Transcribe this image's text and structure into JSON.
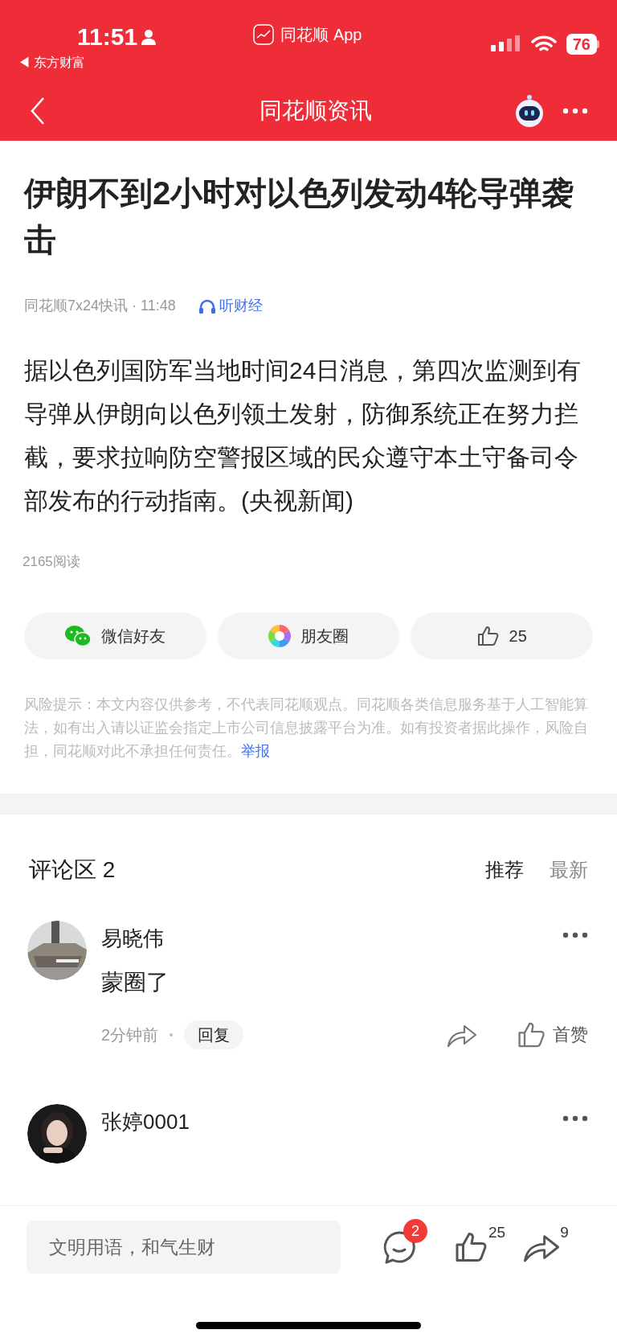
{
  "status_bar": {
    "time": "11:51",
    "app_title": "同花顺 App",
    "back_app": "◀ 东方财富",
    "battery": "76"
  },
  "nav": {
    "title": "同花顺资讯"
  },
  "article": {
    "title": "伊朗不到2小时对以色列发动4轮导弹袭击",
    "source": "同花顺7x24快讯 · 11:48",
    "listen": "听财经",
    "body": "据以色列国防军当地时间24日消息，第四次监测到有导弹从伊朗向以色列领土发射，防御系统正在努力拦截，要求拉响防空警报区域的民众遵守本土守备司令部发布的行动指南。(央视新闻)",
    "reads": "2165阅读"
  },
  "share_buttons": [
    {
      "kind": "wechat",
      "label": "微信好友"
    },
    {
      "kind": "moments",
      "label": "朋友圈"
    },
    {
      "kind": "like",
      "label": "25"
    }
  ],
  "disclaimer": {
    "text": "风险提示：本文内容仅供参考，不代表同花顺观点。同花顺各类信息服务基于人工智能算法，如有出入请以证监会指定上市公司信息披露平台为准。如有投资者据此操作，风险自担，同花顺对此不承担任何责任。",
    "link": "举报"
  },
  "comments_section": {
    "title": "评论区 2",
    "sort_tabs": [
      {
        "label": "推荐",
        "selected": true
      },
      {
        "label": "最新",
        "selected": false
      }
    ],
    "comments": [
      {
        "user": "易晓伟",
        "text": "蒙圈了",
        "time": "2分钟前",
        "reply": "回复",
        "like_label": "首赞"
      },
      {
        "user": "张婷0001"
      }
    ]
  },
  "bottom_bar": {
    "placeholder": "文明用语，和气生财",
    "comment_badge": "2",
    "likes": "25",
    "shares": "9"
  }
}
